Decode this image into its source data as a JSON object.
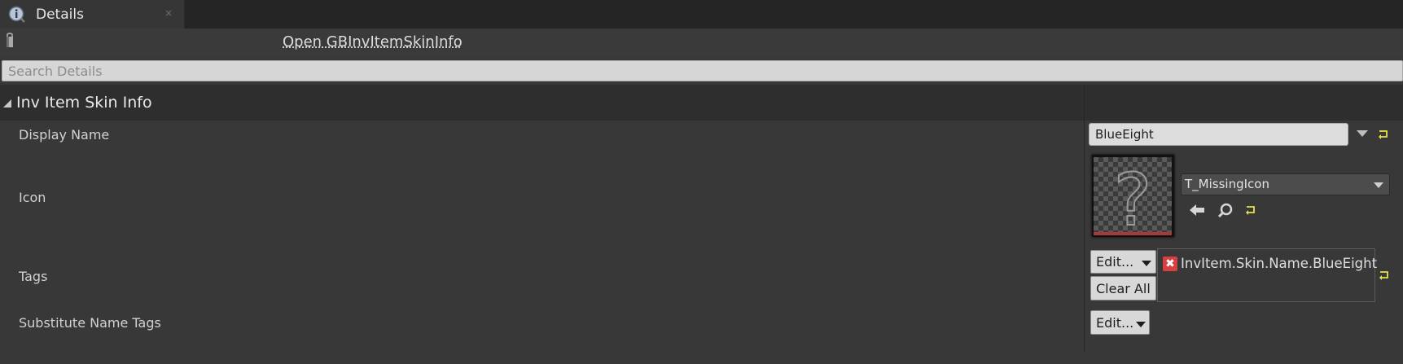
{
  "tab": {
    "title": "Details",
    "close": "×"
  },
  "toolbar": {
    "open_link": "Open GBInvItemSkinInfo"
  },
  "search": {
    "placeholder": "Search Details"
  },
  "category": {
    "title": "Inv Item Skin Info"
  },
  "properties": {
    "display_name": {
      "label": "Display Name",
      "value": "BlueEight"
    },
    "icon": {
      "label": "Icon",
      "asset": "T_MissingIcon",
      "thumbnail_glyph": "?"
    },
    "tags": {
      "label": "Tags",
      "edit_label": "Edit...",
      "clear_label": "Clear All",
      "remove_glyph": "✖",
      "items": [
        "InvItem.Skin.Name.BlueEight"
      ]
    },
    "substitute_name_tags": {
      "label": "Substitute Name Tags",
      "edit_label": "Edit..."
    }
  },
  "colors": {
    "background": "#383838",
    "reset_arrow": "#e5e34a",
    "tag_remove": "#d84040",
    "thumbnail_bar": "#a63a3a"
  }
}
